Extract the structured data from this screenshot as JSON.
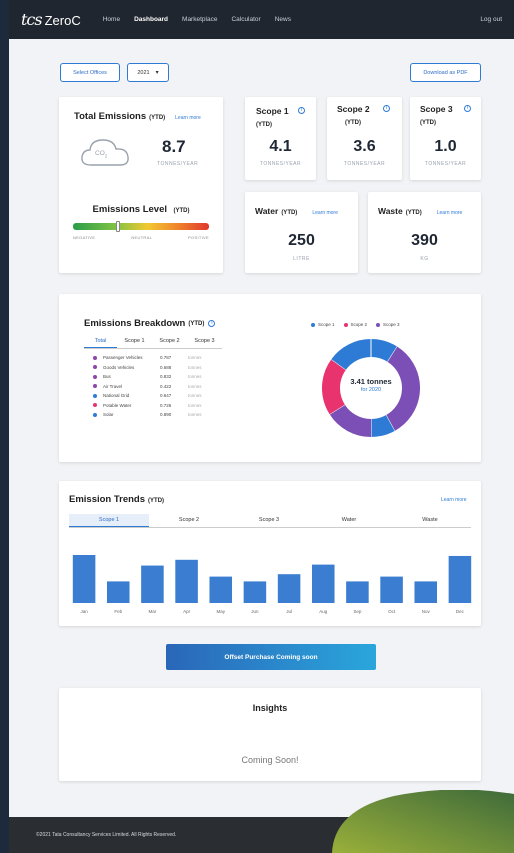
{
  "nav": {
    "logo_mark": "tcs",
    "logo_text": "ZeroC",
    "links": [
      "Home",
      "Dashboard",
      "Marketplace",
      "Calculator",
      "News"
    ],
    "active": "Dashboard",
    "logout": "Log out"
  },
  "toolbar": {
    "select_offices": "Select Offices",
    "year": "2021",
    "download": "Download as PDF"
  },
  "total": {
    "title": "Total Emissions",
    "ytd": "(YTD)",
    "learn": "Learn more",
    "co2": "CO",
    "co2_sub": "2",
    "value": "8.7",
    "unit": "TONNES/YEAR",
    "level_title": "Emissions Level",
    "level_ytd": "(YTD)",
    "level_labels": [
      "NEGATIVE",
      "NEUTRAL",
      "POSITIVE"
    ],
    "level_fraction": 0.33
  },
  "scopes": [
    {
      "title": "Scope 1",
      "ytd": "(YTD)",
      "value": "4.1",
      "unit": "TONNES/YEAR"
    },
    {
      "title": "Scope 2",
      "ytd": "(YTD)",
      "value": "3.6",
      "unit": "TONNES/YEAR"
    },
    {
      "title": "Scope 3",
      "ytd": "(YTD)",
      "value": "1.0",
      "unit": "TONNES/YEAR"
    }
  ],
  "water": {
    "title": "Water",
    "ytd": "(YTD)",
    "learn": "Learn more",
    "value": "250",
    "unit": "LITRE"
  },
  "waste": {
    "title": "Waste",
    "ytd": "(YTD)",
    "learn": "Learn more",
    "value": "390",
    "unit": "KG"
  },
  "breakdown": {
    "title": "Emissions Breakdown",
    "ytd": "(YTD)",
    "tabs": [
      "Total",
      "Scope 1",
      "Scope 2",
      "Scope 3"
    ],
    "items": [
      {
        "label": "Passenger Vehicles",
        "value": "0.787",
        "unit": "tonnes",
        "color": "#8e44ad"
      },
      {
        "label": "Goods Vehicles",
        "value": "0.688",
        "unit": "tonnes",
        "color": "#8e44ad"
      },
      {
        "label": "Bus",
        "value": "0.832",
        "unit": "tonnes",
        "color": "#8e44ad"
      },
      {
        "label": "Air Travel",
        "value": "0.422",
        "unit": "tonnes",
        "color": "#8e44ad"
      },
      {
        "label": "National Grid",
        "value": "0.647",
        "unit": "tonnes",
        "color": "#2e7bd6"
      },
      {
        "label": "Potable Water",
        "value": "0.726",
        "unit": "tonnes",
        "color": "#e8336e"
      },
      {
        "label": "Solar",
        "value": "0.890",
        "unit": "tonnes",
        "color": "#2e7bd6"
      }
    ],
    "legend": [
      {
        "name": "Scope 1",
        "color": "#2e7bd6"
      },
      {
        "name": "Scope 2",
        "color": "#e8336e"
      },
      {
        "name": "Scope 3",
        "color": "#7b4fb5"
      }
    ],
    "donut_center": "3.41 tonnes",
    "donut_sub": "for 2020",
    "donut_segments": [
      {
        "scope": "Scope 1",
        "value": 0.09,
        "color": "#2e7bd6"
      },
      {
        "scope": "Scope 3",
        "value": 0.33,
        "color": "#7b4fb5"
      },
      {
        "scope": "Scope 1",
        "value": 0.08,
        "color": "#2e7bd6"
      },
      {
        "scope": "Scope 3",
        "value": 0.16,
        "color": "#7b4fb5"
      },
      {
        "scope": "Scope 2",
        "value": 0.19,
        "color": "#e8336e"
      },
      {
        "scope": "Scope 1",
        "value": 0.15,
        "color": "#2e7bd6"
      }
    ]
  },
  "trends": {
    "title": "Emission Trends",
    "ytd": "(YTD)",
    "learn": "Learn more",
    "tabs": [
      "Scope 1",
      "Scope 2",
      "Scope 3",
      "Water",
      "Waste"
    ],
    "active_tab": 0
  },
  "chart_data": {
    "type": "bar",
    "categories": [
      "Jan",
      "Feb",
      "Mar",
      "Apr",
      "May",
      "Jun",
      "Jul",
      "Aug",
      "Sep",
      "Oct",
      "Nov",
      "Dec"
    ],
    "values": [
      1.0,
      0.45,
      0.78,
      0.9,
      0.55,
      0.45,
      0.6,
      0.8,
      0.45,
      0.55,
      0.45,
      0.98
    ],
    "ylim": [
      0,
      1.0
    ]
  },
  "offset_button": "Offset Purchase Coming soon",
  "insights": {
    "title": "Insights",
    "body": "Coming Soon!"
  },
  "footer": "©2021 Tata Consultancy Services Limited. All Rights Reserved.",
  "colors": {
    "accent": "#2e7bd6",
    "nav": "#20262f",
    "leaf": "#6e8b2f"
  }
}
